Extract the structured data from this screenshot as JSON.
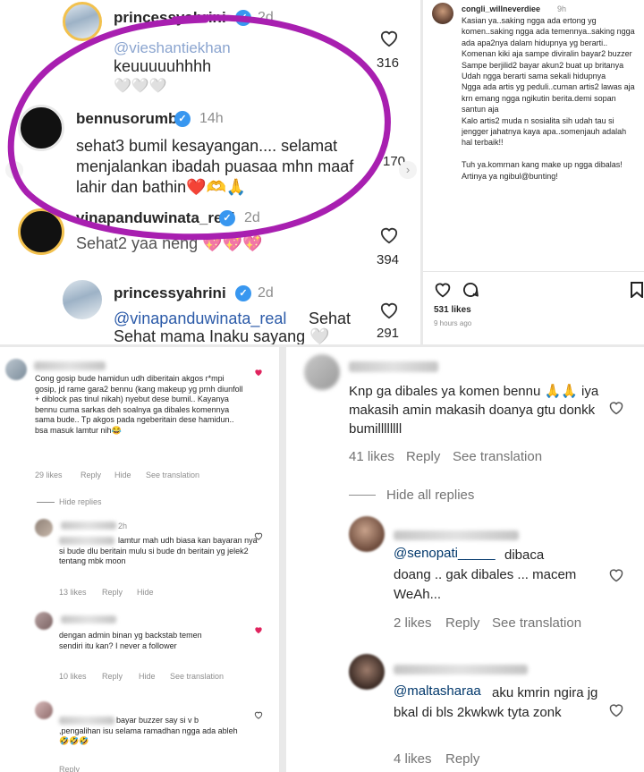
{
  "top_left": {
    "comment1": {
      "username": "princessyahrini",
      "time": "2d",
      "mention": "@vieshantiekhan",
      "text": "keuuuuuhhhh",
      "emoji": "🤍🤍🤍",
      "likes": "316"
    },
    "comment2": {
      "username": "bennusorumba",
      "time": "14h",
      "text": "sehat3 bumil kesayangan.... selamat menjalankan ibadah puasaa mhn maaf lahir dan bathin❤️🫶🙏",
      "likes": "170"
    },
    "comment3": {
      "username": "vinapanduwinata_real",
      "time": "2d",
      "text": "Sehat2 yaa neng 💖💖💖",
      "likes": "394"
    },
    "comment4": {
      "username": "princessyahrini",
      "time": "2d",
      "mention": "@vinapanduwinata_real",
      "text": "Sehat Sehat mama Inaku sayang 🤍🤍",
      "likes": "291"
    },
    "colors": {
      "circle": "#a81fb0",
      "verified": "#3897f0"
    }
  },
  "top_right": {
    "username": "congli_willneverdiee",
    "time": "9h",
    "text": "Kasian ya..saking ngga ada ertong yg komen..saking ngga ada temennya..saking ngga ada apa2nya dalam hidupnya yg berarti..\nKomenan kiki aja sampe diviralin bayar2 buzzer\nSampe berjilid2 bayar akun2 buat up britanya\nUdah ngga berarti sama sekali hidupnya\nNgga ada artis yg peduli..cuman artis2 lawas aja krn emang ngga ngikutin berita.demi sopan santun aja\nKalo artis2 muda n sosialita sih udah tau si jengger jahatnya kaya apa..somenjauh adalah hal terbaik!!\n\nTuh ya.komrnan kang make up ngga dibalas!\nArtinya ya ngibul@bunting!",
    "likes": "531 likes",
    "ago": "9 hours ago"
  },
  "bottom_left": {
    "c1": {
      "text": "Cong gosip bude hamidun udh diberitain akgos r*mpi gosip, jd rame gara2 bennu (kang makeup yg prnh diunfoll + diblock pas tinul nikah) nyebut dese bumil.. Kayanya bennu cuma sarkas deh soalnya ga dibales komennya sama bude.. Tp akgos pada ngeberitain dese hamidun.. bsa masuk lamtur nih😂",
      "likes": "29 likes",
      "reply": "Reply",
      "hide": "Hide",
      "see": "See translation"
    },
    "hide_replies": "Hide replies",
    "c2": {
      "time": "2h",
      "text": "lamtur mah udh biasa kan bayaran nya si bude dlu beritain mulu si bude dn beritain yg jelek2 tentang mbk moon",
      "likes": "13 likes",
      "reply": "Reply",
      "hide": "Hide"
    },
    "c3": {
      "text": "dengan admin binan yg backstab temen sendiri itu kan? I never a follower",
      "likes": "10 likes",
      "reply": "Reply",
      "hide": "Hide",
      "see": "See translation"
    },
    "c4": {
      "text": "bayar buzzer say si v b ,pengalihan isu selama ramadhan ngga ada ableh🤣🤣🤣",
      "reply": "Reply"
    }
  },
  "bottom_right": {
    "c1": {
      "text": "Knp ga dibales ya komen bennu 🙏🙏 iya makasih amin makasih doanya gtu donkk bumillllllll",
      "likes": "41 likes",
      "reply": "Reply",
      "see": "See translation"
    },
    "hide_all": "Hide all replies",
    "c2": {
      "mention": "@senopati_____",
      "text": "dibaca doang .. gak dibales ... macem WeAh...",
      "likes": "2 likes",
      "reply": "Reply",
      "see": "See translation"
    },
    "c3": {
      "mention": "@maltasharaa",
      "text": "aku kmrin ngira jg bkal di bls 2kwkwk tyta zonk",
      "likes": "4 likes",
      "reply": "Reply"
    }
  }
}
